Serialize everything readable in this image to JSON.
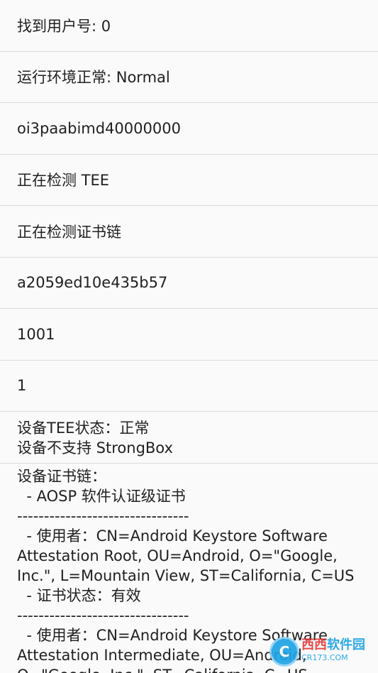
{
  "rows": [
    "找到用户号: 0",
    "运行环境正常: Normal",
    "oi3paabimd40000000",
    "正在检测 TEE",
    "正在检测证书链",
    "a2059ed10e435b57",
    "1001",
    "1"
  ],
  "tee_status": {
    "line1": "设备TEE状态：正常",
    "line2": "设备不支持 StrongBox"
  },
  "cert_chain": {
    "title": "设备证书链：",
    "lines": [
      "  - AOSP 软件认证级证书",
      "--------------------------------",
      "  - 使用者：CN=Android Keystore Software",
      "Attestation Root, OU=Android, O=\"Google,",
      "Inc.\", L=Mountain View, ST=California, C=US",
      "  - 证书状态：有效",
      "--------------------------------",
      "  - 使用者：CN=Android Keystore Software",
      "Attestation Intermediate, OU=Android,",
      "O=\"Google, Inc.\", ST=California, C=US"
    ]
  },
  "watermark": {
    "logo": "C",
    "title_red": "西西",
    "title_blue": "软件园",
    "sub": "CR173.COM"
  }
}
